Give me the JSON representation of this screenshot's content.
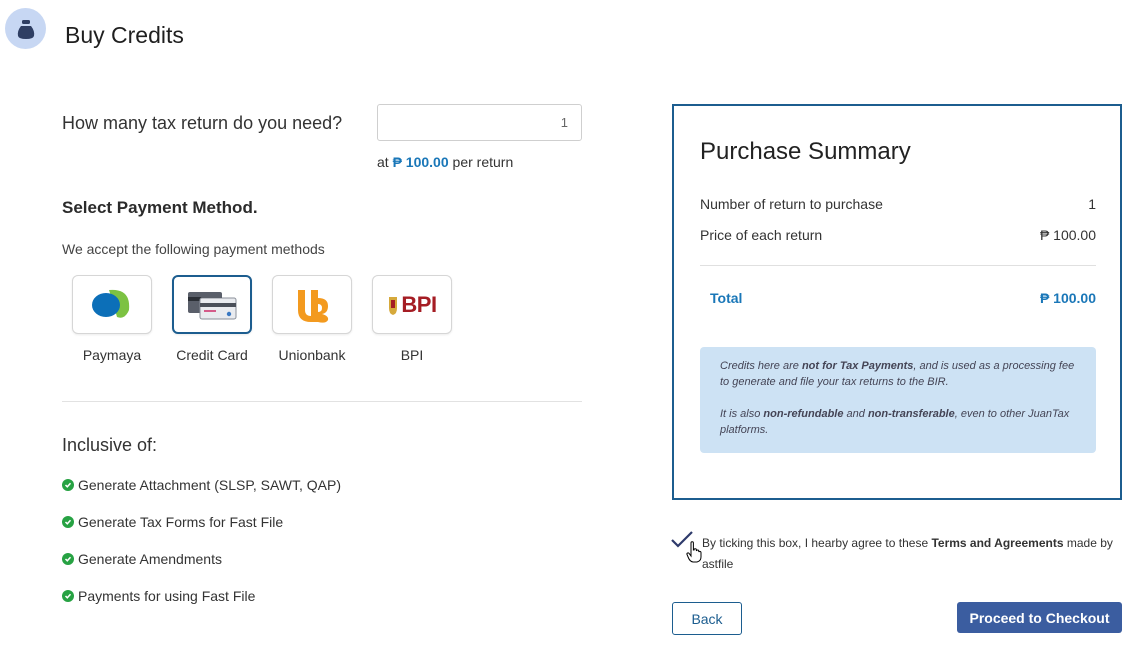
{
  "header": {
    "title": "Buy Credits",
    "icon": "money-bag-icon"
  },
  "quantity": {
    "label": "How many tax return do you need?",
    "value": "1",
    "price_prefix": "at",
    "price": "₱ 100.00",
    "price_suffix": "per return"
  },
  "payment": {
    "title": "Select Payment Method.",
    "subtitle": "We accept the following payment methods",
    "methods": [
      {
        "label": "Paymaya",
        "icon": "paymaya-logo",
        "selected": false
      },
      {
        "label": "Credit Card",
        "icon": "credit-card-icon",
        "selected": true
      },
      {
        "label": "Unionbank",
        "icon": "unionbank-logo",
        "selected": false
      },
      {
        "label": "BPI",
        "icon": "bpi-logo",
        "logo_text": "BPI",
        "selected": false
      }
    ]
  },
  "inclusions": {
    "title": "Inclusive of:",
    "items": [
      "Generate Attachment (SLSP, SAWT, QAP)",
      "Generate Tax Forms for Fast File",
      "Generate Amendments",
      "Payments for using Fast File"
    ]
  },
  "summary": {
    "title": "Purchase Summary",
    "rows": [
      {
        "label": "Number of return to purchase",
        "value": "1"
      },
      {
        "label": "Price of each return",
        "value": "₱ 100.00"
      }
    ],
    "total_label": "Total",
    "total_value": "₱ 100.00",
    "note": {
      "p1_a": "Credits here are ",
      "p1_b": "not for Tax Payments",
      "p1_c": ", and is used as a processing fee to generate and file your tax returns to the BIR.",
      "p2_a": "It is also ",
      "p2_b": "non-refundable",
      "p2_c": " and ",
      "p2_d": "non-transferable",
      "p2_e": ", even to other JuanTax platforms."
    }
  },
  "agreement": {
    "checked": true,
    "text_a": "By ticking this box, I hearby agree to these ",
    "text_b": "Terms and Agreements",
    "text_c": " made by ",
    "text_d": "astfile"
  },
  "actions": {
    "back_label": "Back",
    "checkout_label": "Proceed to Checkout"
  },
  "colors": {
    "accent": "#1c5d8f",
    "link": "#1a77b8",
    "success": "#27a243",
    "note_bg": "#cde2f4",
    "primary_button": "#3b5da0"
  }
}
